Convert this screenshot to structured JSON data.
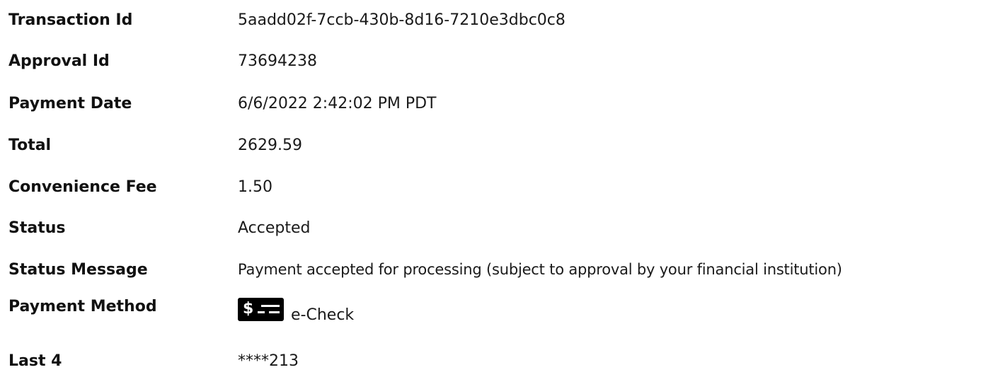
{
  "details": {
    "rows": [
      {
        "label": "Transaction Id",
        "value": "5aadd02f-7ccb-430b-8d16-7210e3dbc0c8"
      },
      {
        "label": "Approval Id",
        "value": "73694238"
      },
      {
        "label": "Payment Date",
        "value": "6/6/2022 2:42:02 PM PDT"
      },
      {
        "label": "Total",
        "value": "2629.59"
      },
      {
        "label": "Convenience Fee",
        "value": "1.50"
      },
      {
        "label": "Status",
        "value": "Accepted"
      },
      {
        "label": "Status Message",
        "value": "Payment accepted for processing (subject to approval by your financial institution)"
      },
      {
        "label": "Payment Method",
        "value": "e-Check",
        "icon": "echeck-icon",
        "icon_glyph": "$"
      },
      {
        "label": "Last 4",
        "value": "****213"
      }
    ]
  }
}
